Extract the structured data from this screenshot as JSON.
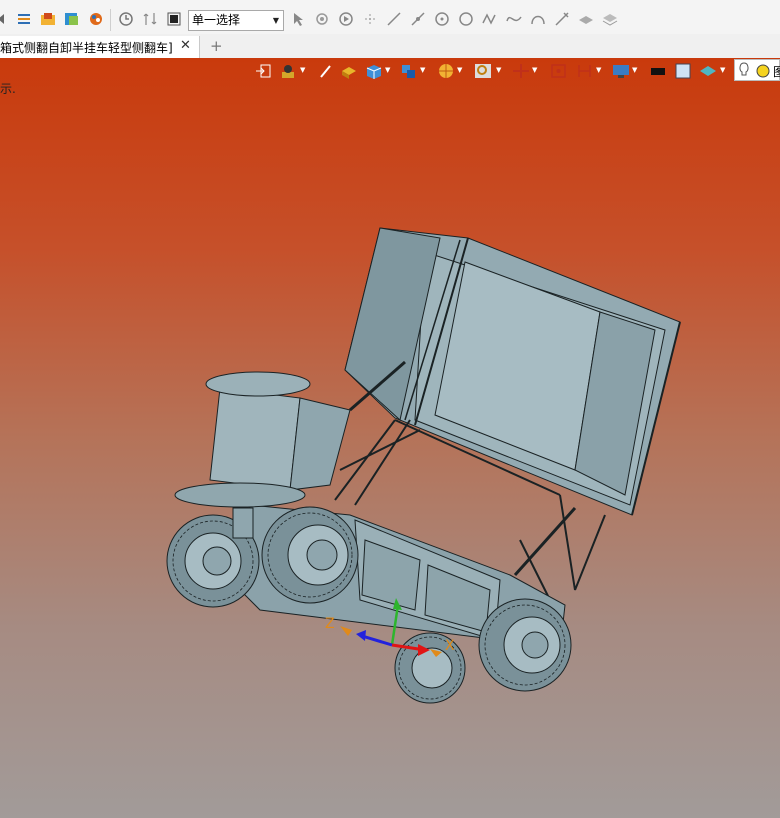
{
  "toolbar": {
    "selection_mode": "单一选择"
  },
  "tab": {
    "title": "箱式侧翻自卸半挂车轻型侧翻车]",
    "close": "✕",
    "add": "+"
  },
  "viewport": {
    "hint_text": "示.",
    "light_label": "图"
  },
  "triad": {
    "x_label": "X",
    "z_label": "Z"
  },
  "colors": {
    "viewport_top": "#c93a0c",
    "viewport_bottom": "#a29b99",
    "model_fill": "#8fa6ae",
    "model_edge": "#1a2224"
  }
}
